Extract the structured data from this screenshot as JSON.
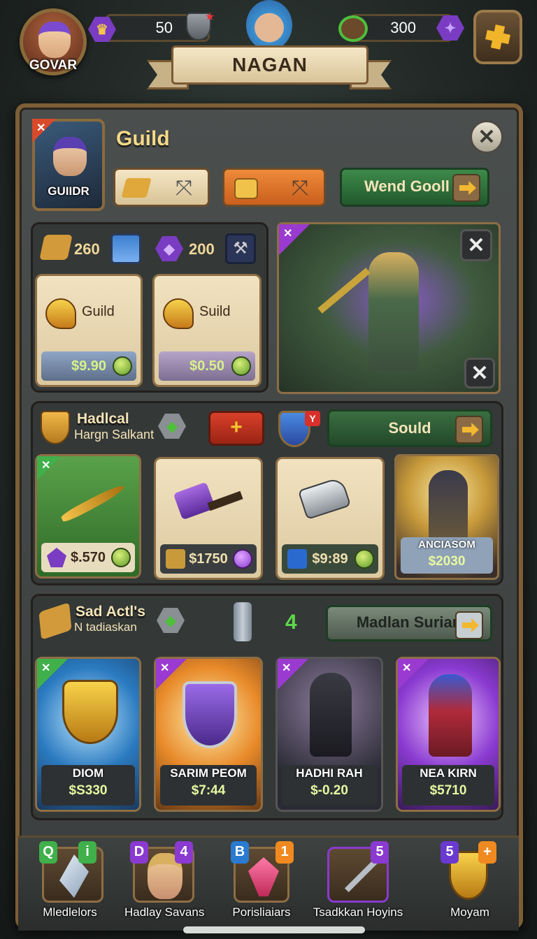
{
  "topbar": {
    "player_name": "GOVAR",
    "gold_value": "50",
    "gem_value": "300",
    "banner_title": "NAGAN"
  },
  "guild": {
    "title": "Guild",
    "portrait_label": "GUIIDR",
    "wend_button": "Wend Gooll",
    "res1": "260",
    "res2": "200",
    "items": [
      {
        "name": "Guild",
        "price": "$9.90"
      },
      {
        "name": "Suild",
        "price": "$0.50"
      }
    ]
  },
  "section2": {
    "title": "Hadlcal",
    "subtitle": "Hargn Salkant",
    "button": "Sould",
    "badge": "Y",
    "items": [
      {
        "price": "$.570"
      },
      {
        "price": "$1750"
      },
      {
        "price": "$9:89"
      },
      {
        "name": "ANCIASOM",
        "price": "$2030"
      }
    ]
  },
  "section3": {
    "title": "Sad Actl's",
    "subtitle": "N tadiaskan",
    "count": "4",
    "button": "Madlan Surian",
    "items": [
      {
        "name": "DIOM",
        "price": "$S330"
      },
      {
        "name": "SARIM PEOM",
        "price": "$7:44"
      },
      {
        "name": "HADHI RAH",
        "price": "$-0.20"
      },
      {
        "name": "NEA KIRN",
        "price": "$5710"
      }
    ]
  },
  "footer": [
    {
      "label": "Mledlelors",
      "badge1": "Q",
      "badge2": "i"
    },
    {
      "label": "Hadlay Savans",
      "badge1": "D",
      "badge2": "4"
    },
    {
      "label": "Porisliaiars",
      "badge1": "B",
      "badge2": "1"
    },
    {
      "label": "Tsadkkan Hoyins",
      "badge1": "",
      "badge2": "5"
    },
    {
      "label": "Moyam",
      "badge1": "5",
      "badge2": "+"
    }
  ],
  "colors": {
    "accent_gold": "#f5d98a",
    "price_green": "#d7f08a",
    "panel_border": "#7c5e37"
  }
}
